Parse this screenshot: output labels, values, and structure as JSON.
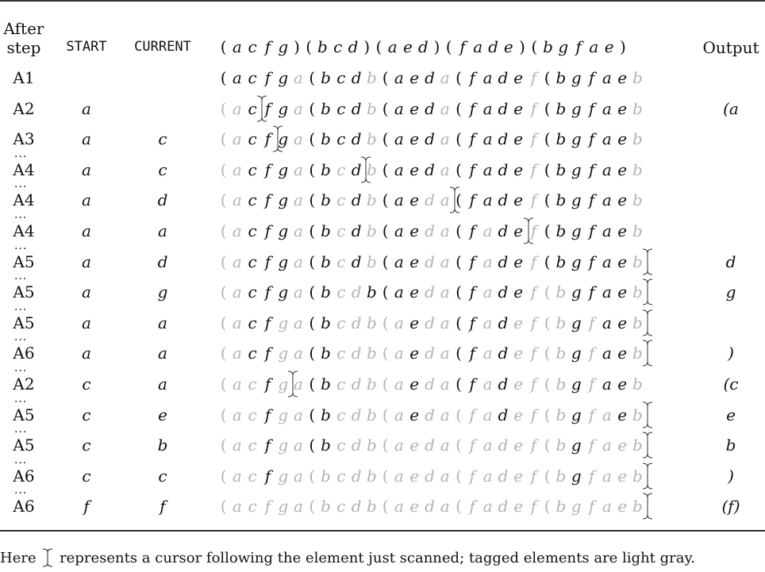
{
  "table": {
    "headers": {
      "step_line1": "After",
      "step_line2": "step",
      "start": "START",
      "current": "CURRENT",
      "permutation": [
        "(",
        "a",
        "c",
        "f",
        "g",
        ")",
        "(",
        "b",
        "c",
        "d",
        ")",
        "(",
        "a",
        "e",
        "d",
        ")",
        "(",
        "f",
        "a",
        "d",
        "e",
        ")",
        "(",
        "b",
        "g",
        "f",
        "a",
        "e",
        ")"
      ],
      "output": "Output"
    },
    "rows": [
      {
        "step": "A1",
        "dots": false,
        "start": "",
        "current": "",
        "output": "",
        "cursor": null,
        "tokens": [
          "(a",
          "c",
          "f",
          "g",
          "a*",
          "(b",
          "c",
          "d",
          "b*",
          "(a",
          "e",
          "d",
          "a*",
          "(f",
          "a",
          "d",
          "e",
          "f*",
          "(b",
          "g",
          "f",
          "a",
          "e",
          "b*"
        ]
      },
      {
        "step": "A2",
        "dots": false,
        "start": "a",
        "current": "",
        "output": "(a",
        "cursor": 1,
        "tokens": [
          "(a*",
          "c",
          "f",
          "g",
          "a*",
          "(b",
          "c",
          "d",
          "b*",
          "(a",
          "e",
          "d",
          "a*",
          "(f",
          "a",
          "d",
          "e",
          "f*",
          "(b",
          "g",
          "f",
          "a",
          "e",
          "b*"
        ]
      },
      {
        "step": "A3",
        "dots": false,
        "start": "a",
        "current": "c",
        "output": "",
        "cursor": 2,
        "tokens": [
          "(a*",
          "c",
          "f",
          "g",
          "a*",
          "(b",
          "c",
          "d",
          "b*",
          "(a",
          "e",
          "d",
          "a*",
          "(f",
          "a",
          "d",
          "e",
          "f*",
          "(b",
          "g",
          "f",
          "a",
          "e",
          "b*"
        ]
      },
      {
        "step": "A4",
        "dots": true,
        "start": "a",
        "current": "c",
        "output": "",
        "cursor": 7,
        "tokens": [
          "(a*",
          "c",
          "f",
          "g",
          "a*",
          "(b",
          "c*",
          "d",
          "b*",
          "(a",
          "e",
          "d",
          "a*",
          "(f",
          "a",
          "d",
          "e",
          "f*",
          "(b",
          "g",
          "f",
          "a",
          "e",
          "b*"
        ]
      },
      {
        "step": "A4",
        "dots": true,
        "start": "a",
        "current": "d",
        "output": "",
        "cursor": 12,
        "tokens": [
          "(a*",
          "c",
          "f",
          "g",
          "a*",
          "(b",
          "c*",
          "d",
          "b*",
          "(a",
          "e",
          "d*",
          "a*",
          "(f",
          "a",
          "d",
          "e",
          "f*",
          "(b",
          "g",
          "f",
          "a",
          "e",
          "b*"
        ]
      },
      {
        "step": "A4",
        "dots": true,
        "start": "a",
        "current": "a",
        "output": "",
        "cursor": 16,
        "tokens": [
          "(a*",
          "c",
          "f",
          "g",
          "a*",
          "(b",
          "c*",
          "d",
          "b*",
          "(a",
          "e",
          "d*",
          "a*",
          "(f",
          "a*",
          "d",
          "e",
          "f*",
          "(b",
          "g",
          "f",
          "a",
          "e",
          "b*"
        ]
      },
      {
        "step": "A5",
        "dots": true,
        "start": "a",
        "current": "d",
        "output": "d",
        "cursor": 25,
        "tokens": [
          "(a*",
          "c",
          "f",
          "g",
          "a*",
          "(b",
          "c*",
          "d",
          "b*",
          "(a",
          "e",
          "d*",
          "a*",
          "(f",
          "a*",
          "d",
          "e",
          "f*",
          "(b",
          "g",
          "f",
          "a",
          "e",
          "b*"
        ]
      },
      {
        "step": "A5",
        "dots": true,
        "start": "a",
        "current": "g",
        "output": "g",
        "cursor": 25,
        "tokens": [
          "(a*",
          "c",
          "f",
          "g",
          "a*",
          "(b",
          "c*",
          "d*",
          "b",
          "(a",
          "e",
          "d*",
          "a*",
          "(f",
          "a*",
          "d",
          "e",
          "f*",
          "(b*",
          "g",
          "f",
          "a",
          "e",
          "b*"
        ]
      },
      {
        "step": "A5",
        "dots": true,
        "start": "a",
        "current": "a",
        "output": "",
        "cursor": 25,
        "tokens": [
          "(a*",
          "c",
          "f",
          "g*",
          "a*",
          "(b",
          "c*",
          "d*",
          "b*",
          "(a*",
          "e",
          "d*",
          "a*",
          "(f",
          "a*",
          "d",
          "e*",
          "f*",
          "(b*",
          "g",
          "f*",
          "a",
          "e",
          "b*"
        ]
      },
      {
        "step": "A6",
        "dots": true,
        "start": "a",
        "current": "a",
        "output": ")",
        "cursor": 25,
        "tokens": [
          "(a*",
          "c",
          "f",
          "g*",
          "a*",
          "(b",
          "c*",
          "d*",
          "b*",
          "(a*",
          "e",
          "d*",
          "a*",
          "(f",
          "a*",
          "d",
          "e*",
          "f*",
          "(b*",
          "g",
          "f*",
          "a",
          "e",
          "b*"
        ]
      },
      {
        "step": "A2",
        "dots": true,
        "start": "c",
        "current": "a",
        "output": "(c",
        "cursor": 3,
        "tokens": [
          "(a*",
          "c*",
          "f",
          "g*",
          "a*",
          "(b",
          "c*",
          "d*",
          "b*",
          "(a*",
          "e",
          "d*",
          "a*",
          "(f",
          "a*",
          "d",
          "e*",
          "f*",
          "(b*",
          "g",
          "f*",
          "a",
          "e",
          "b*"
        ]
      },
      {
        "step": "A5",
        "dots": true,
        "start": "c",
        "current": "e",
        "output": "e",
        "cursor": 25,
        "tokens": [
          "(a*",
          "c*",
          "f",
          "g*",
          "a*",
          "(b",
          "c*",
          "d*",
          "b*",
          "(a*",
          "e",
          "d*",
          "a*",
          "(f*",
          "a*",
          "d",
          "e*",
          "f*",
          "(b*",
          "g",
          "f*",
          "a*",
          "e",
          "b*"
        ]
      },
      {
        "step": "A5",
        "dots": true,
        "start": "c",
        "current": "b",
        "output": "b",
        "cursor": 25,
        "tokens": [
          "(a*",
          "c*",
          "f",
          "g*",
          "a*",
          "(b",
          "c*",
          "d*",
          "b*",
          "(a*",
          "e*",
          "d*",
          "a*",
          "(f*",
          "a*",
          "d*",
          "e*",
          "f*",
          "(b*",
          "g",
          "f*",
          "a*",
          "e*",
          "b*"
        ]
      },
      {
        "step": "A6",
        "dots": true,
        "start": "c",
        "current": "c",
        "output": ")",
        "cursor": 25,
        "tokens": [
          "(a*",
          "c*",
          "f",
          "g*",
          "a*",
          "(b*",
          "c*",
          "d*",
          "b*",
          "(a*",
          "e*",
          "d*",
          "a*",
          "(f*",
          "a*",
          "d*",
          "e*",
          "f*",
          "(b*",
          "g",
          "f*",
          "a*",
          "e*",
          "b*"
        ]
      },
      {
        "step": "A6",
        "dots": true,
        "start": "f",
        "current": "f",
        "output": "(f)",
        "cursor": 25,
        "tokens": [
          "(a*",
          "c*",
          "f*",
          "g*",
          "a*",
          "(b*",
          "c*",
          "d*",
          "b*",
          "(a*",
          "e*",
          "d*",
          "a*",
          "(f*",
          "a*",
          "d*",
          "e*",
          "f*",
          "(b*",
          "g*",
          "f*",
          "a*",
          "e*",
          "b*"
        ]
      }
    ]
  },
  "footnote": {
    "before": "Here",
    "after": "represents a cursor following the element just scanned; tagged elements are light gray."
  },
  "colors": {
    "tagged": "#b3b3b3",
    "untagged": "#111111",
    "rule": "#333333"
  }
}
